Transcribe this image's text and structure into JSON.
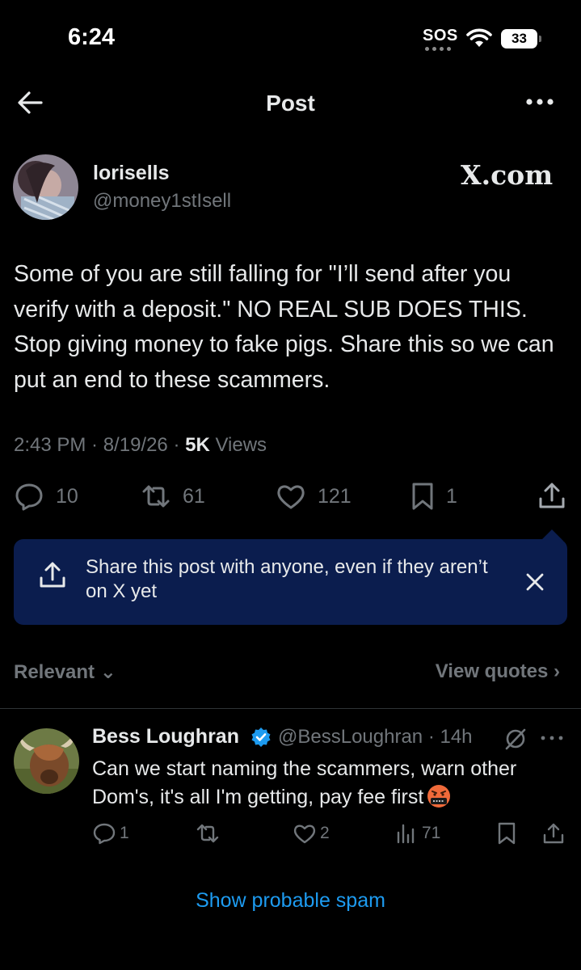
{
  "status_bar": {
    "time": "6:24",
    "sos": "SOS",
    "battery": "33"
  },
  "header": {
    "title": "Post"
  },
  "post": {
    "author_name": "lorisells",
    "author_handle": "@money1stIsell",
    "source_badge": "X.com",
    "text": "Some of you are still falling for \"I’ll send after you verify with a deposit.\" NO REAL SUB DOES THIS. Stop giving money to fake pigs. Share this so we can put an end to these scammers.",
    "timestamp": "2:43 PM · 8/19/26 · ",
    "views_count": "5K",
    "views_label": " Views",
    "replies": "10",
    "reposts": "61",
    "likes": "121",
    "bookmarks": "1"
  },
  "share_tip": {
    "text": "Share this post with anyone, even if they aren’t on X yet"
  },
  "filters": {
    "relevant": "Relevant ⌄",
    "view_quotes": "View quotes ›"
  },
  "reply": {
    "author_name": "Bess Loughran",
    "handle_time": "@BessLoughran · 14h",
    "text": "Can we start naming the scammers, warn other Dom's, it's all I'm getting, pay fee first",
    "replies": "1",
    "likes": "2",
    "views": "71"
  },
  "show_spam": "Show probable spam",
  "colors": {
    "accent": "#1d9bf0",
    "muted": "#71767b",
    "card": "#0b1d4e",
    "background": "#000000"
  }
}
